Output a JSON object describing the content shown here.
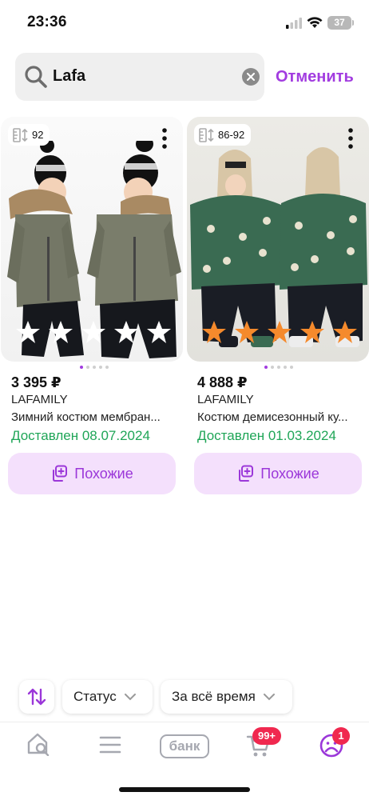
{
  "status_bar": {
    "time": "23:36",
    "battery": "37"
  },
  "search": {
    "value": "Lafa",
    "cancel_label": "Отменить"
  },
  "products": [
    {
      "size": "92",
      "price": "3 395 ₽",
      "brand": "LAFAMILY",
      "name": "Зимний костюм мембран...",
      "delivery": "Доставлен 08.07.2024",
      "rating": 0,
      "similar_label": "Похожие"
    },
    {
      "size": "86-92",
      "price": "4 888 ₽",
      "brand": "LAFAMILY",
      "name": "Костюм демисезонный ку...",
      "delivery": "Доставлен 01.03.2024",
      "rating": 5,
      "similar_label": "Похожие"
    }
  ],
  "filters": {
    "status_label": "Статус",
    "period_label": "За всё время"
  },
  "tab_bar": {
    "bank_label": "банк",
    "cart_badge": "99+",
    "profile_badge": "1"
  },
  "colors": {
    "accent": "#a23ce0",
    "delivered": "#1fa557",
    "star_filled": "#f58a2c",
    "badge": "#f0284f"
  }
}
